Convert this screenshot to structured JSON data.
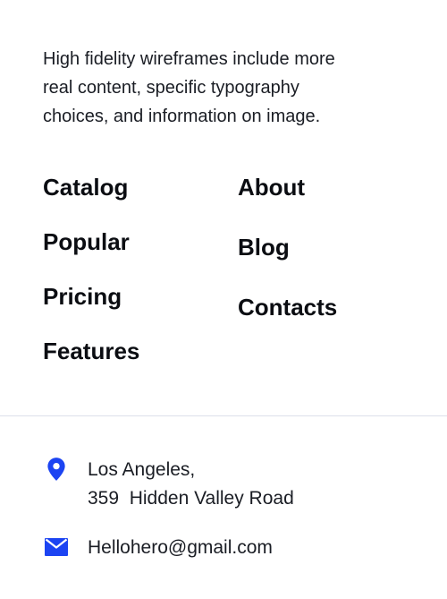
{
  "description": {
    "line1": "High fidelity wireframes include more",
    "line2": "real content, specific typography",
    "line3": "choices, and information on image."
  },
  "nav": {
    "left": [
      "Catalog",
      "Popular",
      "Pricing",
      "Features"
    ],
    "right": [
      "About",
      "Blog",
      "Contacts"
    ]
  },
  "contact": {
    "address_line1": "Los Angeles,",
    "address_line2": "359  Hidden Valley Road",
    "email": "Hellohero@gmail.com",
    "icons": {
      "address": "location-pin-icon",
      "email": "envelope-icon"
    }
  },
  "colors": {
    "accent": "#1c44f2",
    "text": "#111318",
    "divider": "#dde0ea",
    "background": "#ffffff"
  }
}
